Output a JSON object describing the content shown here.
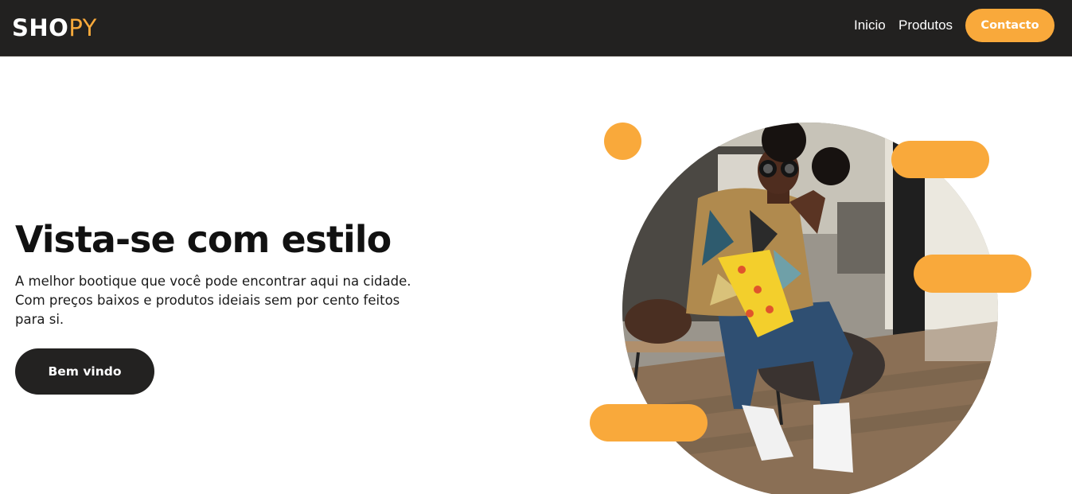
{
  "header": {
    "logo_part1": "SHO",
    "logo_part2": "PY",
    "nav": [
      "Inicio",
      "Produtos"
    ],
    "contact_label": "Contacto"
  },
  "hero": {
    "title": "Vista-se com estilo",
    "description": "A melhor bootique que você pode encontrar aqui na cidade. Com preços baixos e produtos ideiais sem por cento feitos para si.",
    "cta_label": "Bem vindo"
  },
  "colors": {
    "accent": "#f9a93b",
    "dark": "#222120",
    "background": "#ffffff"
  }
}
